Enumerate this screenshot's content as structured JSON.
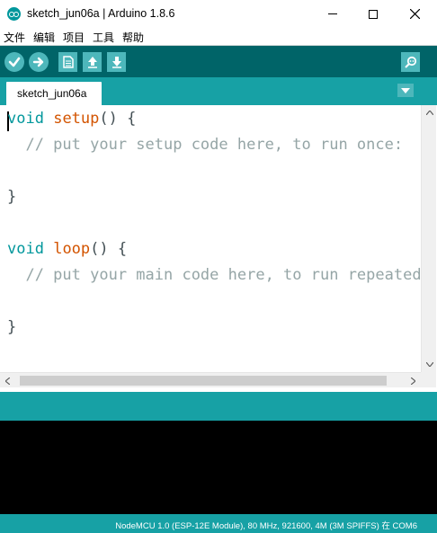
{
  "window": {
    "title": "sketch_jun06a | Arduino 1.8.6"
  },
  "menu": {
    "items": [
      "文件",
      "编辑",
      "项目",
      "工具",
      "帮助"
    ]
  },
  "toolbar": {
    "buttons": [
      "verify",
      "upload",
      "new",
      "open",
      "save",
      "serial-monitor"
    ]
  },
  "tabs": {
    "active": "sketch_jun06a"
  },
  "code": {
    "lines": [
      "void setup() {",
      "  // put your setup code here, to run once:",
      "",
      "}",
      "",
      "void loop() {",
      "  // put your main code here, to run repeatedl",
      "",
      "}"
    ],
    "l0_kw": "void",
    "l0_fn": "setup",
    "l0_rest": "() {",
    "l1": "  // put your setup code here, to run once:",
    "l3": "}",
    "l5_kw": "void",
    "l5_fn": "loop",
    "l5_rest": "() {",
    "l6": "  // put your main code here, to run repeatedl",
    "l8": "}"
  },
  "colors": {
    "toolbar": "#006468",
    "tabstrip": "#17a1a5",
    "button": "#4db7bb",
    "keyword": "#00979c",
    "function": "#d35400",
    "comment": "#95a5a6",
    "console": "#000000"
  },
  "status": {
    "board": "NodeMCU 1.0 (ESP-12E Module), 80 MHz, 921600, 4M (3M SPIFFS) 在 COM6"
  }
}
